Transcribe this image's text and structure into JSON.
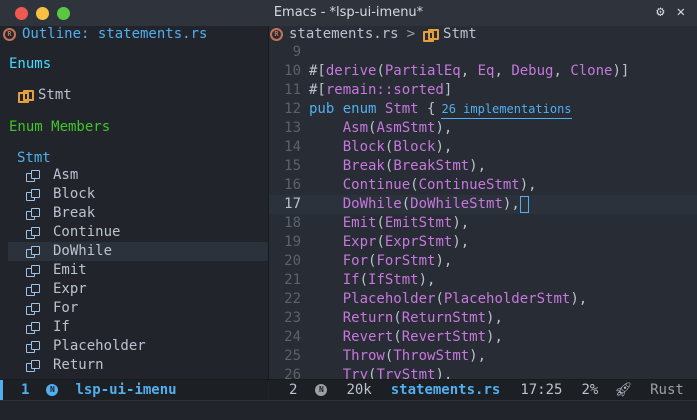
{
  "window": {
    "title": "Emacs - *lsp-ui-imenu*"
  },
  "outline": {
    "header": "Outline: statements.rs",
    "enums_label": "Enums",
    "enum_item": "Stmt",
    "members_label": "Enum Members",
    "group_label": "Stmt",
    "members": [
      "Asm",
      "Block",
      "Break",
      "Continue",
      "DoWhile",
      "Emit",
      "Expr",
      "For",
      "If",
      "Placeholder",
      "Return"
    ],
    "selected_index": 4
  },
  "editor": {
    "breadcrumb_file": "statements.rs",
    "breadcrumb_sep": ">",
    "breadcrumb_symbol": "Stmt",
    "impl_lens": "26 implementations",
    "lines": [
      {
        "n": "9",
        "text": ""
      },
      {
        "n": "10",
        "text": "#[derive(PartialEq, Eq, Debug, Clone)]"
      },
      {
        "n": "11",
        "text": "#[remain::sorted]"
      },
      {
        "n": "12",
        "text": "pub enum Stmt {"
      },
      {
        "n": "13",
        "text": "    Asm(AsmStmt),"
      },
      {
        "n": "14",
        "text": "    Block(Block),"
      },
      {
        "n": "15",
        "text": "    Break(BreakStmt),"
      },
      {
        "n": "16",
        "text": "    Continue(ContinueStmt),"
      },
      {
        "n": "17",
        "text": "    DoWhile(DoWhileStmt),"
      },
      {
        "n": "18",
        "text": "    Emit(EmitStmt),"
      },
      {
        "n": "19",
        "text": "    Expr(ExprStmt),"
      },
      {
        "n": "20",
        "text": "    For(ForStmt),"
      },
      {
        "n": "21",
        "text": "    If(IfStmt),"
      },
      {
        "n": "22",
        "text": "    Placeholder(PlaceholderStmt),"
      },
      {
        "n": "23",
        "text": "    Return(ReturnStmt),"
      },
      {
        "n": "24",
        "text": "    Revert(RevertStmt),"
      },
      {
        "n": "25",
        "text": "    Throw(ThrowStmt),"
      },
      {
        "n": "26",
        "text": "    Try(TryStmt),"
      }
    ],
    "current_line": "17"
  },
  "modeline_left": {
    "window_num": "1",
    "badge": "N",
    "buffer": "lsp-ui-imenu"
  },
  "modeline_right": {
    "window_num": "2",
    "badge": "N",
    "size": "20k",
    "file": "statements.rs",
    "position": "17:25",
    "percent": "2%",
    "mode": "Rust"
  },
  "colors": {
    "accent": "#51afef",
    "keyword": "#c678dd",
    "background": "#282c34"
  }
}
